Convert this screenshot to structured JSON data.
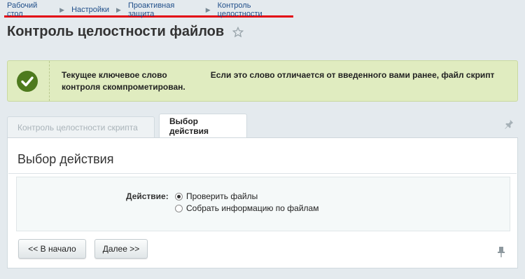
{
  "breadcrumb": {
    "items": [
      "Рабочий стол",
      "Настройки",
      "Проактивная защита",
      "Контроль целостности"
    ],
    "accent_color": "#e30613"
  },
  "page": {
    "title": "Контроль целостности файлов",
    "favorite_icon": "star-icon"
  },
  "notice": {
    "icon": "check-circle-icon",
    "line1_left": "Текущее ключевое слово",
    "line1_right": "Если это слово отличается от введенного вами ранее, файл скрипт",
    "line2": "контроля скомпрометирован.",
    "color": "#4e7a1e"
  },
  "tabs": {
    "items": [
      {
        "label": "Контроль целостности скрипта",
        "active": false
      },
      {
        "label": "Выбор действия",
        "active": true
      }
    ],
    "pin_icon": "pin-icon"
  },
  "panel": {
    "title": "Выбор действия",
    "field_label": "Действие:",
    "options": [
      {
        "label": "Проверить файлы",
        "selected": true
      },
      {
        "label": "Собрать информацию по файлам",
        "selected": false
      }
    ]
  },
  "buttons": {
    "back": "<< В начало",
    "next": "Далее >>"
  }
}
